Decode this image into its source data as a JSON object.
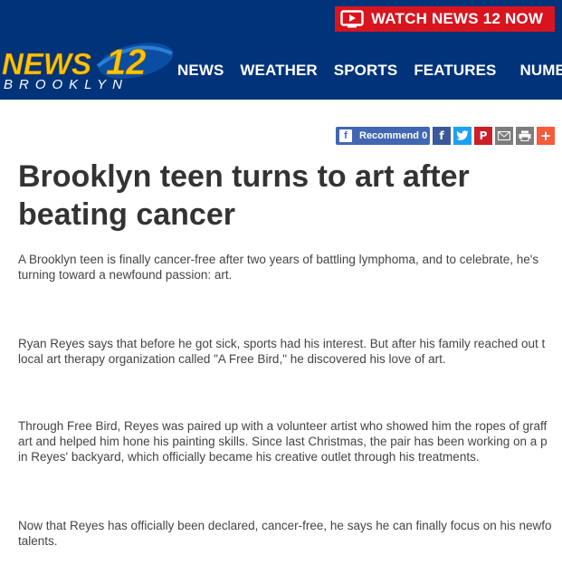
{
  "header": {
    "watch_label": "WATCH NEWS 12 NOW",
    "logo": {
      "brand": "NEWS 12",
      "region": "BROOKLYN"
    },
    "nav": [
      {
        "label": "NEWS"
      },
      {
        "label": "WEATHER"
      },
      {
        "label": "SPORTS"
      },
      {
        "label": "FEATURES"
      },
      {
        "label": "NUMBER"
      }
    ]
  },
  "share": {
    "recommend_label": "Recommend 0",
    "icons": [
      "facebook-icon",
      "twitter-icon",
      "pinterest-icon",
      "email-icon",
      "print-icon",
      "more-icon"
    ]
  },
  "article": {
    "headline_line1": "Brooklyn teen turns to art after",
    "headline_line2": "beating cancer",
    "paragraphs": [
      {
        "line1": "A Brooklyn teen is finally cancer-free after two years of battling lymphoma, and to celebrate, he's",
        "line2": "turning toward a newfound passion: art."
      },
      {
        "line1": "Ryan Reyes says that before he got sick, sports had his interest. But after his family reached out t",
        "line2": "local art therapy organization called \"A Free Bird,\" he discovered his love of art."
      },
      {
        "line1": "Through Free Bird, Reyes was paired up with a volunteer artist who showed him the ropes of graff",
        "line2": "art and helped him hone his painting skills. Since last Christmas, the pair has been working on a p",
        "line3": "in Reyes' backyard, which officially became his creative outlet through his treatments."
      },
      {
        "line1": "Now that Reyes has officially been declared, cancer-free, he says he can finally focus on his newfo",
        "line2": "talents."
      }
    ]
  },
  "colors": {
    "header_bg": "#00337a",
    "watch_red": "#d8151f",
    "logo_yellow": "#ffc20e"
  }
}
